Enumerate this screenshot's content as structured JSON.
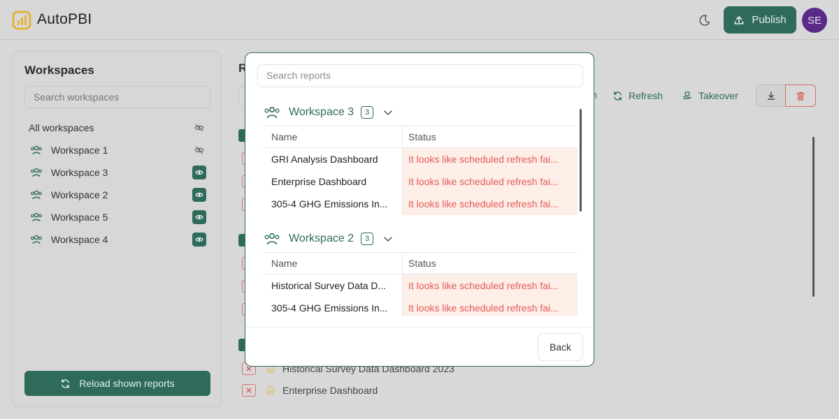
{
  "header": {
    "brand": "AutoPBI",
    "publish_label": "Publish",
    "avatar_initials": "SE",
    "accent_color": "#2e6b5a"
  },
  "sidebar": {
    "title": "Workspaces",
    "search_placeholder": "Search workspaces",
    "all_label": "All workspaces",
    "items": [
      {
        "label": "Workspace 1",
        "visible": false
      },
      {
        "label": "Workspace 3",
        "visible": true
      },
      {
        "label": "Workspace 2",
        "visible": true
      },
      {
        "label": "Workspace 5",
        "visible": true
      },
      {
        "label": "Workspace 4",
        "visible": true
      }
    ],
    "reload_label": "Reload shown reports"
  },
  "main": {
    "title_fragment": "R",
    "toolbar": {
      "fragment": "h",
      "refresh_label": "Refresh",
      "takeover_label": "Takeover"
    },
    "rows": [
      {
        "label": "Historical Survey Data Dashboard 2023"
      },
      {
        "label": "Enterprise Dashboard"
      }
    ]
  },
  "modal": {
    "search_placeholder": "Search reports",
    "columns": {
      "name": "Name",
      "status": "Status"
    },
    "groups": [
      {
        "workspace": "Workspace 3",
        "count": "3",
        "rows": [
          {
            "name": "GRI Analysis Dashboard",
            "status": "It looks like scheduled refresh fai..."
          },
          {
            "name": "Enterprise Dashboard",
            "status": "It looks like scheduled refresh fai..."
          },
          {
            "name": "305-4 GHG Emissions In...",
            "status": "It looks like scheduled refresh fai..."
          }
        ]
      },
      {
        "workspace": "Workspace 2",
        "count": "3",
        "rows": [
          {
            "name": "Historical Survey Data D...",
            "status": "It looks like scheduled refresh fai..."
          },
          {
            "name": "305-4 GHG Emissions In...",
            "status": "It looks like scheduled refresh fai..."
          }
        ]
      }
    ],
    "back_label": "Back"
  }
}
